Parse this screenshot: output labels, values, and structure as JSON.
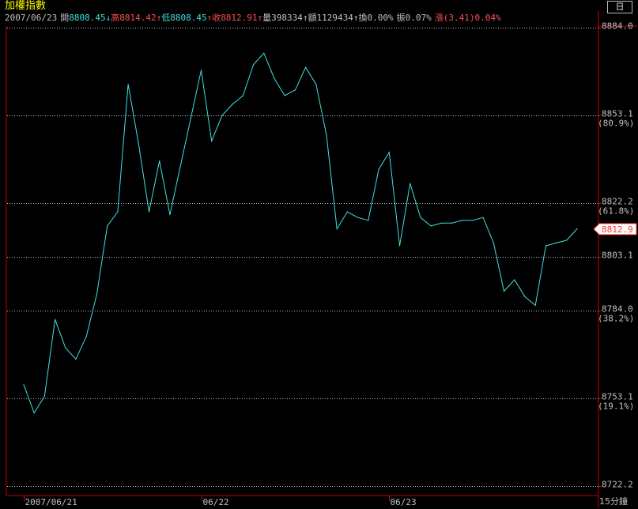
{
  "title": "加權指數",
  "info": {
    "date": "2007/06/23",
    "open_label": "開",
    "open": "8808.45",
    "open_arrow": "↓",
    "high_label": "高",
    "high": "8814.42",
    "high_arrow": "↑",
    "low_label": "低",
    "low": "8808.45",
    "low_arrow": "↑",
    "close_label": "收",
    "close": "8812.91",
    "close_arrow": "↑",
    "volume_label": "量",
    "volume": "398334",
    "volume_arrow": "↑",
    "amount_label": "額",
    "amount": "1129434",
    "amount_arrow": "↑",
    "turnover_label": "換",
    "turnover": "0.00%",
    "amplitude_label": "振",
    "amplitude": "0.07%",
    "change_label": "漲",
    "change": "(3.41)",
    "change_pct": "0.04%"
  },
  "top_button": "日",
  "period_label": "15分鐘",
  "colors": {
    "background": "#000000",
    "line": "#40e0e0",
    "axis": "#c00000",
    "grid": "#c0c0c0",
    "price_box": "#ff3030"
  },
  "chart_data": {
    "type": "line",
    "title": "",
    "xlabel": "",
    "ylabel": "",
    "ylim": [
      8722.2,
      8884.0
    ],
    "yticks": [
      {
        "value": 8884.0,
        "label": "8884.0",
        "pct": ""
      },
      {
        "value": 8853.1,
        "label": "8853.1",
        "pct": "80.9%"
      },
      {
        "value": 8822.2,
        "label": "8822.2",
        "pct": "61.8%"
      },
      {
        "value": 8803.1,
        "label": "8803.1",
        "pct": ""
      },
      {
        "value": 8784.0,
        "label": "8784.0",
        "pct": "38.2%"
      },
      {
        "value": 8753.1,
        "label": "8753.1",
        "pct": "19.1%"
      },
      {
        "value": 8722.2,
        "label": "8722.2",
        "pct": ""
      }
    ],
    "xticks": [
      {
        "index": 0,
        "label": "2007/06/21"
      },
      {
        "index": 17,
        "label": "06/22"
      },
      {
        "index": 35,
        "label": "06/23"
      }
    ],
    "last_value": "8812.9",
    "series": [
      {
        "values": [
          8758,
          8748,
          8754,
          8781,
          8771,
          8767,
          8775,
          8790,
          8814,
          8819,
          8864,
          8843,
          8819,
          8837,
          8818,
          8835,
          8852,
          8869,
          8844,
          8853,
          8857,
          8860,
          8871,
          8875,
          8866,
          8860,
          8862,
          8870,
          8864,
          8846,
          8813,
          8819,
          8817,
          8816,
          8834,
          8840,
          8807,
          8829,
          8817,
          8814,
          8815,
          8815,
          8816,
          8816,
          8817,
          8808,
          8791,
          8795,
          8789,
          8786,
          8807,
          8808,
          8809,
          8813
        ]
      }
    ]
  }
}
